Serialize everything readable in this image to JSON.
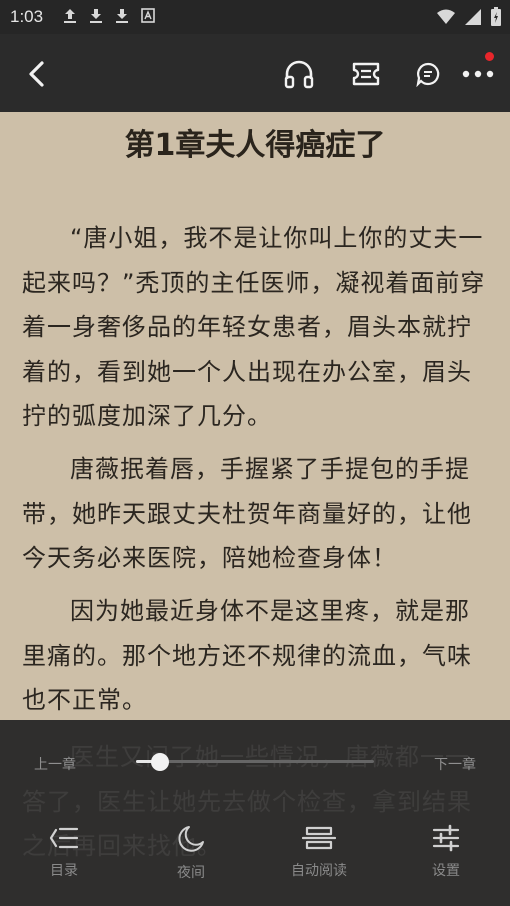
{
  "status_bar": {
    "time": "1:03"
  },
  "header": {
    "back": "back",
    "icons": [
      "headphones-icon",
      "ticket-icon",
      "comment-icon",
      "more-icon"
    ],
    "notification_color": "#e8262b"
  },
  "chapter": {
    "title": "第1章夫人得癌症了",
    "paragraphs": [
      "“唐小姐，我不是让你叫上你的丈夫一起来吗？”秃顶的主任医师，凝视着面前穿着一身奢侈品的年轻女患者，眉头本就拧着的，看到她一个人出现在办公室，眉头拧的弧度加深了几分。",
      "唐薇抿着唇，手握紧了手提包的手提带，她昨天跟丈夫杜贺年商量好的，让他今天务必来医院，陪她检查身体！",
      "因为她最近身体不是这里疼，就是那里痛的。那个地方还不规律的流血，气味也不正常。"
    ],
    "hidden_text": "医生又问了她一些情况，唐薇都一一答了，医生让她先去做个检查，拿到结果之后再回来找他。"
  },
  "bottom": {
    "prev_label": "上一章",
    "next_label": "下一章",
    "progress": 0.1,
    "nav": [
      {
        "label": "目录",
        "icon": "toc-icon"
      },
      {
        "label": "夜间",
        "icon": "moon-icon"
      },
      {
        "label": "自动阅读",
        "icon": "auto-read-icon"
      },
      {
        "label": "设置",
        "icon": "settings-icon"
      }
    ]
  }
}
